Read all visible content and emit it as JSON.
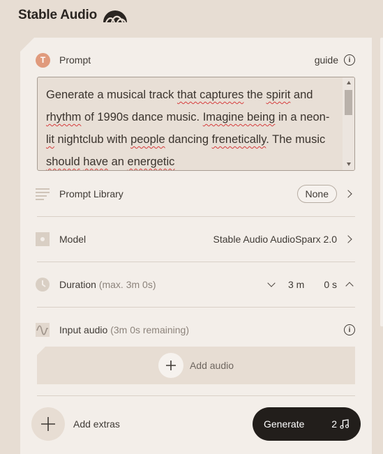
{
  "brand": {
    "name": "Stable Audio",
    "logo_icon": "waveform-arch-logo"
  },
  "prompt": {
    "badge_letter": "T",
    "label": "Prompt",
    "guide_label": "guide",
    "text_parts": [
      {
        "t": "Generate a musical track ",
        "s": false
      },
      {
        "t": "that captures",
        "s": true
      },
      {
        "t": " the ",
        "s": false
      },
      {
        "t": "spirit",
        "s": true
      },
      {
        "t": " and ",
        "s": false
      },
      {
        "t": "rhythm",
        "s": true
      },
      {
        "t": " of 1990s dance music. ",
        "s": false
      },
      {
        "t": "Imagine being",
        "s": true
      },
      {
        "t": " in a neon-",
        "s": false
      },
      {
        "t": "lit",
        "s": true
      },
      {
        "t": " nightclub with ",
        "s": false
      },
      {
        "t": "people",
        "s": true
      },
      {
        "t": " dancing ",
        "s": false
      },
      {
        "t": "frenetically",
        "s": true
      },
      {
        "t": ". The music ",
        "s": false
      },
      {
        "t": "should",
        "s": true
      },
      {
        "t": " ",
        "s": false
      },
      {
        "t": "have",
        "s": true
      },
      {
        "t": " an ",
        "s": false
      },
      {
        "t": "energetic",
        "s": true
      }
    ]
  },
  "prompt_library": {
    "label": "Prompt Library",
    "value": "None"
  },
  "model": {
    "label": "Model",
    "value": "Stable Audio AudioSparx 2.0"
  },
  "duration": {
    "label": "Duration",
    "hint": "(max. 3m 0s)",
    "minutes": "3 m",
    "seconds": "0 s"
  },
  "input_audio": {
    "label": "Input audio",
    "hint": "(3m 0s remaining)",
    "add_label": "Add audio"
  },
  "footer": {
    "add_extras_label": "Add extras",
    "generate_label": "Generate",
    "credits": "2"
  },
  "colors": {
    "accent": "#e09a7c",
    "panel": "#f3eee9",
    "background": "#e7ddd3",
    "button": "#221e1b"
  }
}
